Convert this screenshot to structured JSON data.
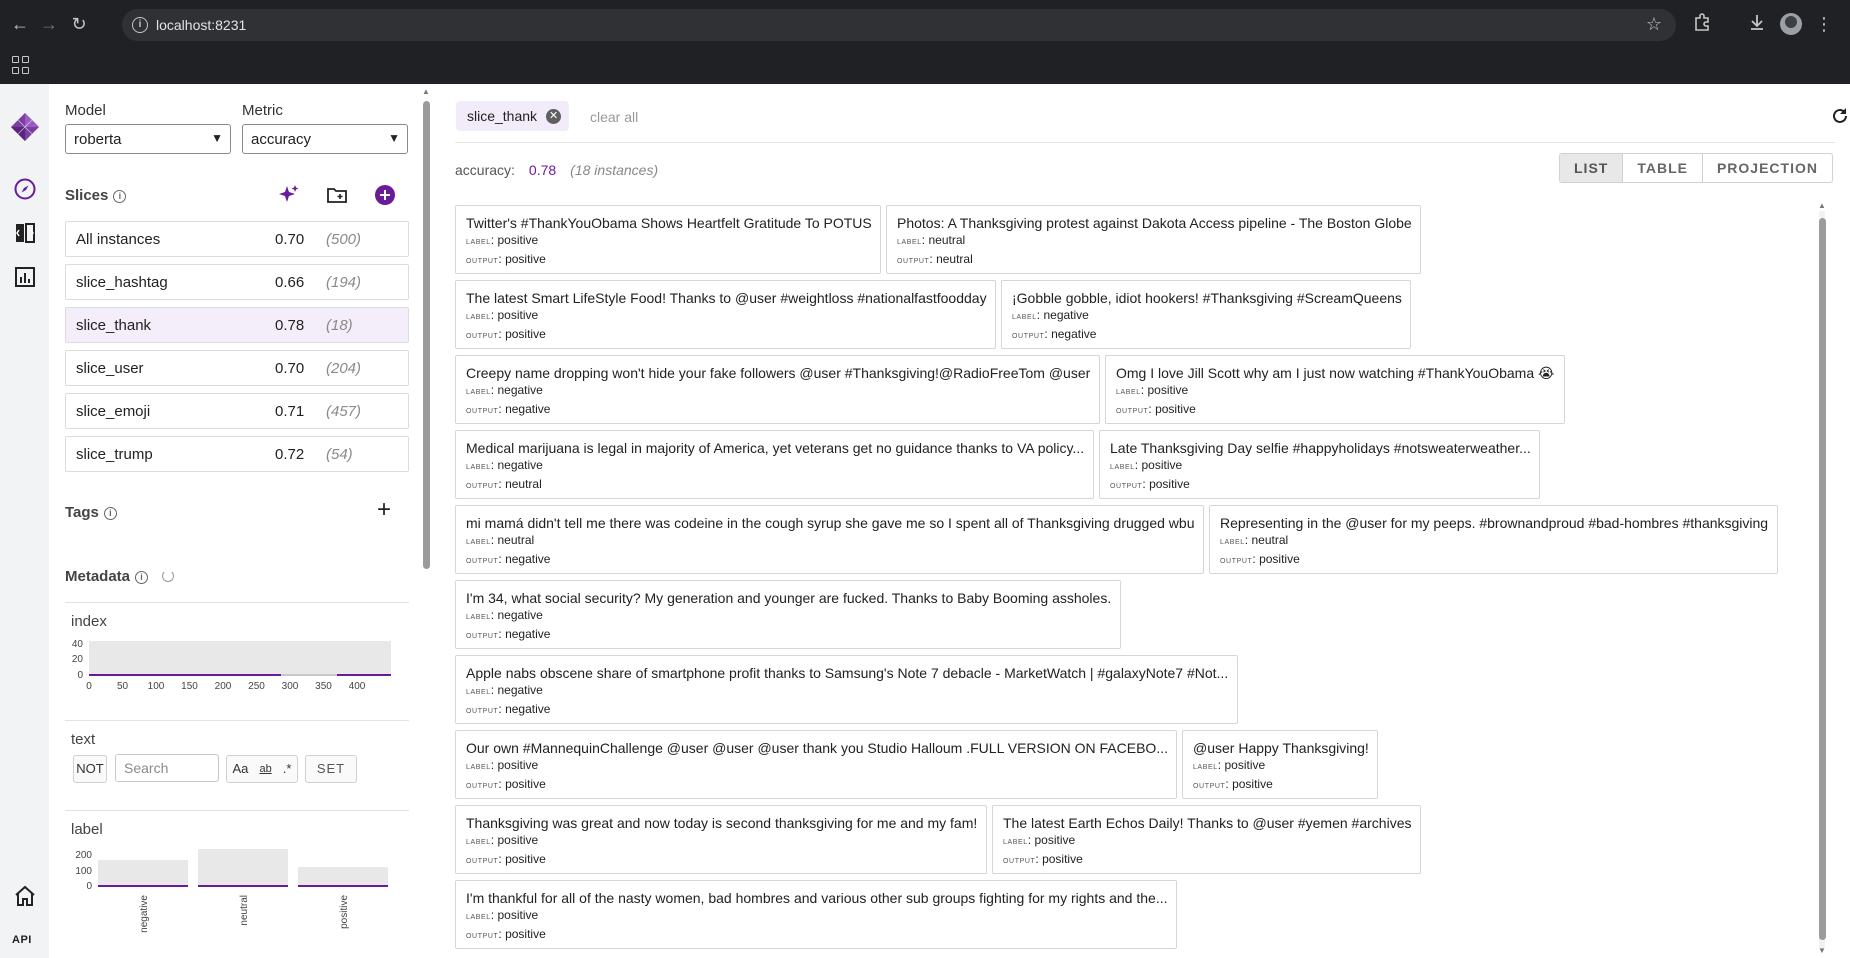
{
  "browser": {
    "url": "localhost:8231"
  },
  "sidebar": {
    "model_label": "Model",
    "model_value": "roberta",
    "metric_label": "Metric",
    "metric_value": "accuracy",
    "slices_title": "Slices",
    "slices": [
      {
        "name": "All instances",
        "value": "0.70",
        "count": "(500)",
        "selected": false
      },
      {
        "name": "slice_hashtag",
        "value": "0.66",
        "count": "(194)",
        "selected": false
      },
      {
        "name": "slice_thank",
        "value": "0.78",
        "count": "(18)",
        "selected": true
      },
      {
        "name": "slice_user",
        "value": "0.70",
        "count": "(204)",
        "selected": false
      },
      {
        "name": "slice_emoji",
        "value": "0.71",
        "count": "(457)",
        "selected": false
      },
      {
        "name": "slice_trump",
        "value": "0.72",
        "count": "(54)",
        "selected": false
      }
    ],
    "tags_title": "Tags",
    "metadata_title": "Metadata",
    "index_chart": {
      "title": "index",
      "y_ticks": [
        "40",
        "20",
        "0"
      ],
      "x_ticks": [
        "0",
        "50",
        "100",
        "150",
        "200",
        "250",
        "300",
        "350",
        "400"
      ]
    },
    "text_filter": {
      "title": "text",
      "not_label": "NOT",
      "search_placeholder": "Search",
      "case_label": "Aa",
      "word_label": "ab",
      "regex_label": ".*",
      "set_label": "SET"
    },
    "label_chart": {
      "title": "label",
      "y_ticks": [
        "200",
        "100",
        "0"
      ],
      "categories": [
        "negative",
        "neutral",
        "positive"
      ]
    },
    "api_label": "API"
  },
  "main": {
    "active_slice_chip": "slice_thank",
    "clear_all": "clear all",
    "metric_name": "accuracy:",
    "metric_value": "0.78",
    "instances": "(18 instances)",
    "views": [
      "LIST",
      "TABLE",
      "PROJECTION"
    ],
    "active_view": "LIST",
    "label_key": "label",
    "output_key": "output",
    "rows": [
      [
        {
          "text": "Twitter's #ThankYouObama Shows Heartfelt Gratitude To POTUS",
          "label": "positive",
          "output": "positive"
        },
        {
          "text": "Photos: A Thanksgiving protest against Dakota Access pipeline - The Boston Globe",
          "label": "neutral",
          "output": "neutral"
        }
      ],
      [
        {
          "text": "The latest Smart LifeStyle Food! Thanks to @user #weightloss #nationalfastfoodday",
          "label": "positive",
          "output": "positive"
        },
        {
          "text": "¡Gobble gobble, idiot hookers! #Thanksgiving #ScreamQueens",
          "label": "negative",
          "output": "negative"
        }
      ],
      [
        {
          "text": "Creepy name dropping won't hide your fake followers @user #Thanksgiving!@RadioFreeTom @user",
          "label": "negative",
          "output": "negative"
        },
        {
          "text": "Omg I love Jill Scott why am I just now watching #ThankYouObama 😭",
          "label": "positive",
          "output": "positive"
        }
      ],
      [
        {
          "text": "Medical marijuana is legal in majority of America, yet veterans get no guidance thanks to VA policy...",
          "label": "negative",
          "output": "neutral"
        },
        {
          "text": "Late Thanksgiving Day selfie #happyholidays #notsweaterweather...",
          "label": "positive",
          "output": "positive"
        }
      ],
      [
        {
          "text": "mi mamá didn't tell me there was codeine in the cough syrup she gave me so I spent all of Thanksgiving drugged wbu",
          "label": "neutral",
          "output": "negative"
        },
        {
          "text": "Representing in the @user for my peeps. #brownandproud #bad-hombres #thanksgiving",
          "label": "neutral",
          "output": "positive"
        }
      ],
      [
        {
          "text": "I'm 34, what social security? My generation and younger are fucked. Thanks to Baby Booming assholes.",
          "label": "negative",
          "output": "negative"
        }
      ],
      [
        {
          "text": "Apple nabs obscene share of smartphone profit thanks to Samsung's Note 7 debacle - MarketWatch | #galaxyNote7 #Not...",
          "label": "negative",
          "output": "negative"
        }
      ],
      [
        {
          "text": "Our own #MannequinChallenge @user @user @user thank you Studio Halloum .FULL VERSION ON FACEBO...",
          "label": "positive",
          "output": "positive"
        },
        {
          "text": "@user Happy Thanksgiving!",
          "label": "positive",
          "output": "positive"
        }
      ],
      [
        {
          "text": "Thanksgiving was great and now today is second thanksgiving for me and my fam!",
          "label": "positive",
          "output": "positive"
        },
        {
          "text": "The latest Earth Echos Daily! Thanks to @user #yemen #archives",
          "label": "positive",
          "output": "positive"
        }
      ],
      [
        {
          "text": "I'm thankful for all of the nasty women, bad hombres and various other sub groups fighting for my rights and the...",
          "label": "positive",
          "output": "positive"
        }
      ]
    ]
  },
  "colors": {
    "accent": "#6a1b9a",
    "selected_bg": "#f3eefa",
    "chip_bg": "#f1ebfa"
  }
}
